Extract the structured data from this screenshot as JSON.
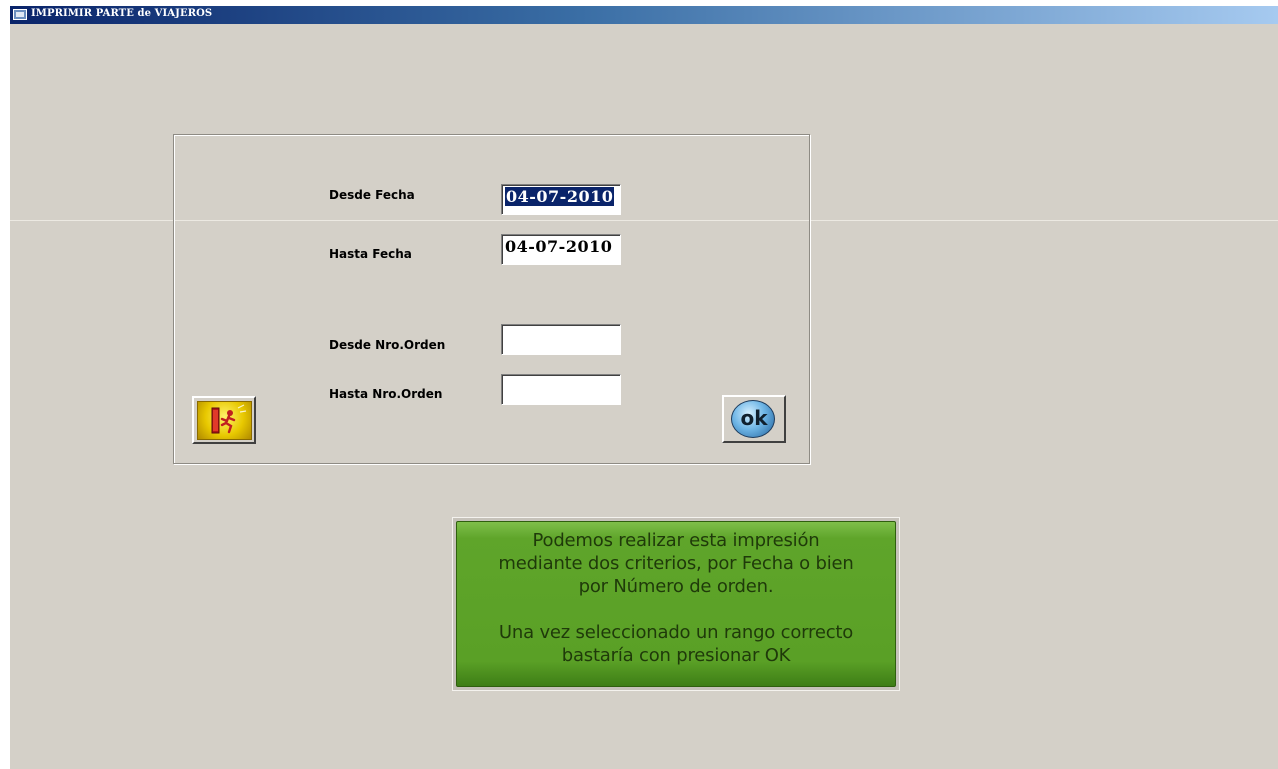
{
  "window": {
    "title": "IMPRIMIR PARTE de VIAJEROS"
  },
  "form": {
    "desde_fecha_label": "Desde  Fecha",
    "desde_fecha_value": "04-07-2010",
    "hasta_fecha_label": "Hasta  Fecha",
    "hasta_fecha_value": "04-07-2010",
    "desde_orden_label": "Desde Nro.Orden",
    "desde_orden_value": "",
    "hasta_orden_label": "Hasta Nro.Orden",
    "hasta_orden_value": ""
  },
  "buttons": {
    "ok_label": "ok",
    "exit_icon": "exit-door-running-man-icon"
  },
  "help": {
    "lines": [
      "Podemos realizar esta impresión",
      "mediante dos criterios, por Fecha o bien",
      "por Número de orden.",
      "",
      "Una vez seleccionado un rango correcto",
      "bastaría con presionar OK"
    ]
  },
  "colors": {
    "titlebar_start": "#0a246a",
    "window_bg": "#d4d0c8",
    "help_bg": "#5aa026",
    "selection": "#0a246a"
  }
}
